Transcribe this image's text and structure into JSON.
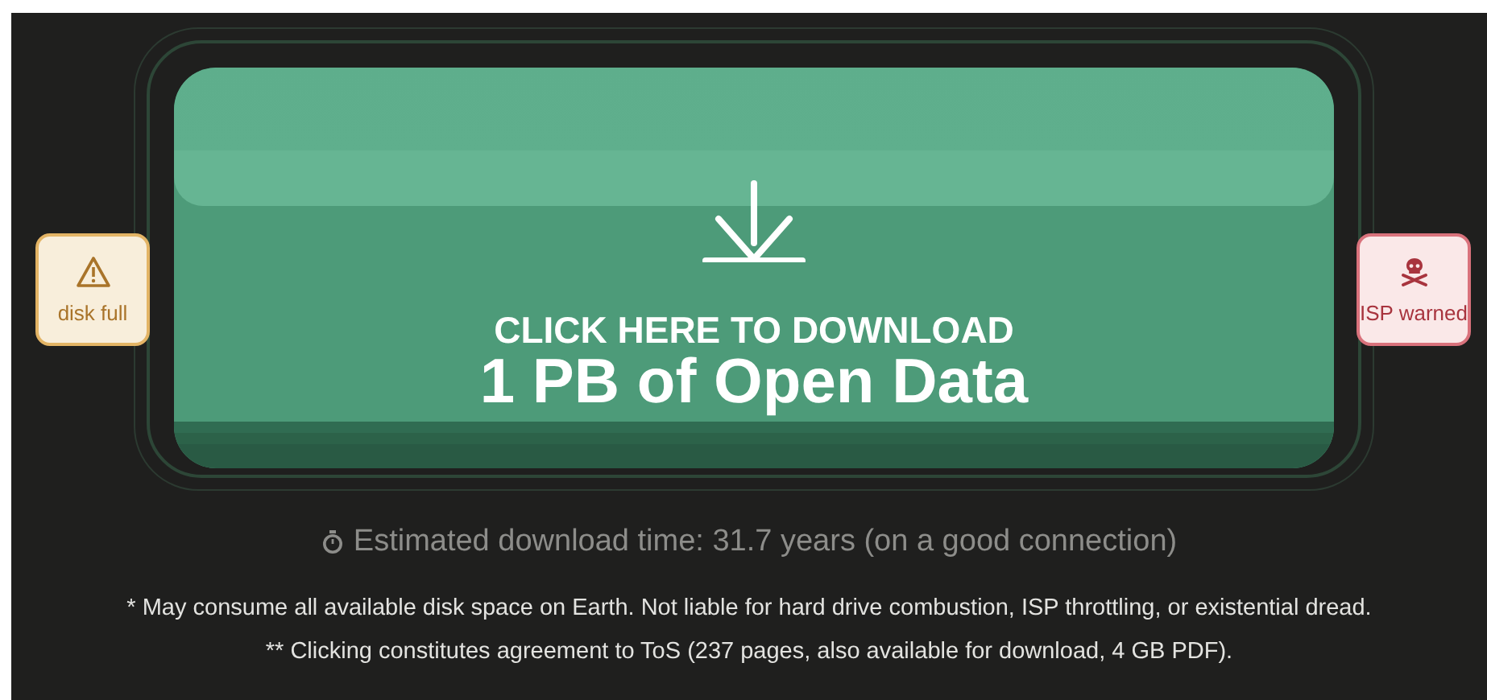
{
  "download_button": {
    "line_1": "CLICK HERE TO DOWNLOAD",
    "line_2": "1 PB of Open Data"
  },
  "badges": [
    {
      "kind": "warning",
      "label": "disk full"
    },
    {
      "kind": "danger",
      "label": "ISP warned"
    }
  ],
  "estimate": "Estimated download time: 31.7 years (on a good connection)",
  "footnotes": [
    "* May consume all available disk space on Earth. Not liable for hard drive combustion, ISP throttling, or existential dread.",
    "** Clicking constitutes agreement to ToS (237 pages, also available for download, 4 GB PDF)."
  ]
}
